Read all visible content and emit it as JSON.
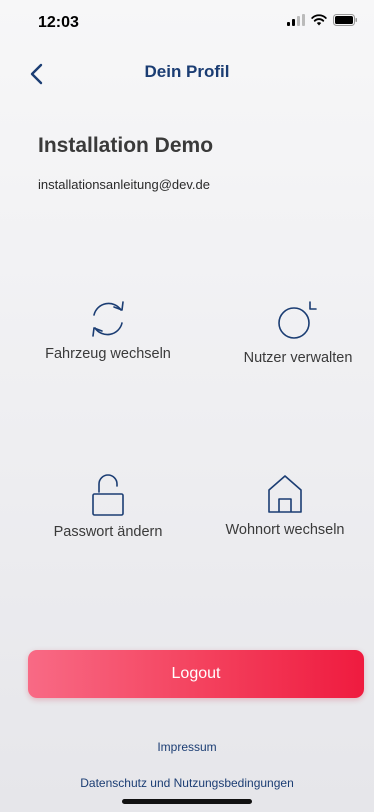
{
  "status_bar": {
    "time": "12:03"
  },
  "nav": {
    "title": "Dein Profil",
    "back_icon": "chevron-left-icon"
  },
  "profile": {
    "name": "Installation Demo",
    "email": "installationsanleitung@dev.de"
  },
  "actions": [
    {
      "label": "Fahrzeug wechseln",
      "icon": "refresh-icon"
    },
    {
      "label": "Nutzer verwalten",
      "icon": "users-icon"
    },
    {
      "label": "Passwort ändern",
      "icon": "unlock-icon"
    },
    {
      "label": "Wohnort wechseln",
      "icon": "home-icon"
    }
  ],
  "logout": {
    "label": "Logout"
  },
  "links": {
    "impressum": "Impressum",
    "privacy": "Datenschutz und Nutzungsbedingungen"
  },
  "colors": {
    "accent": "#1b3d73",
    "logout_start": "#f86a85",
    "logout_end": "#ef1b3f"
  }
}
